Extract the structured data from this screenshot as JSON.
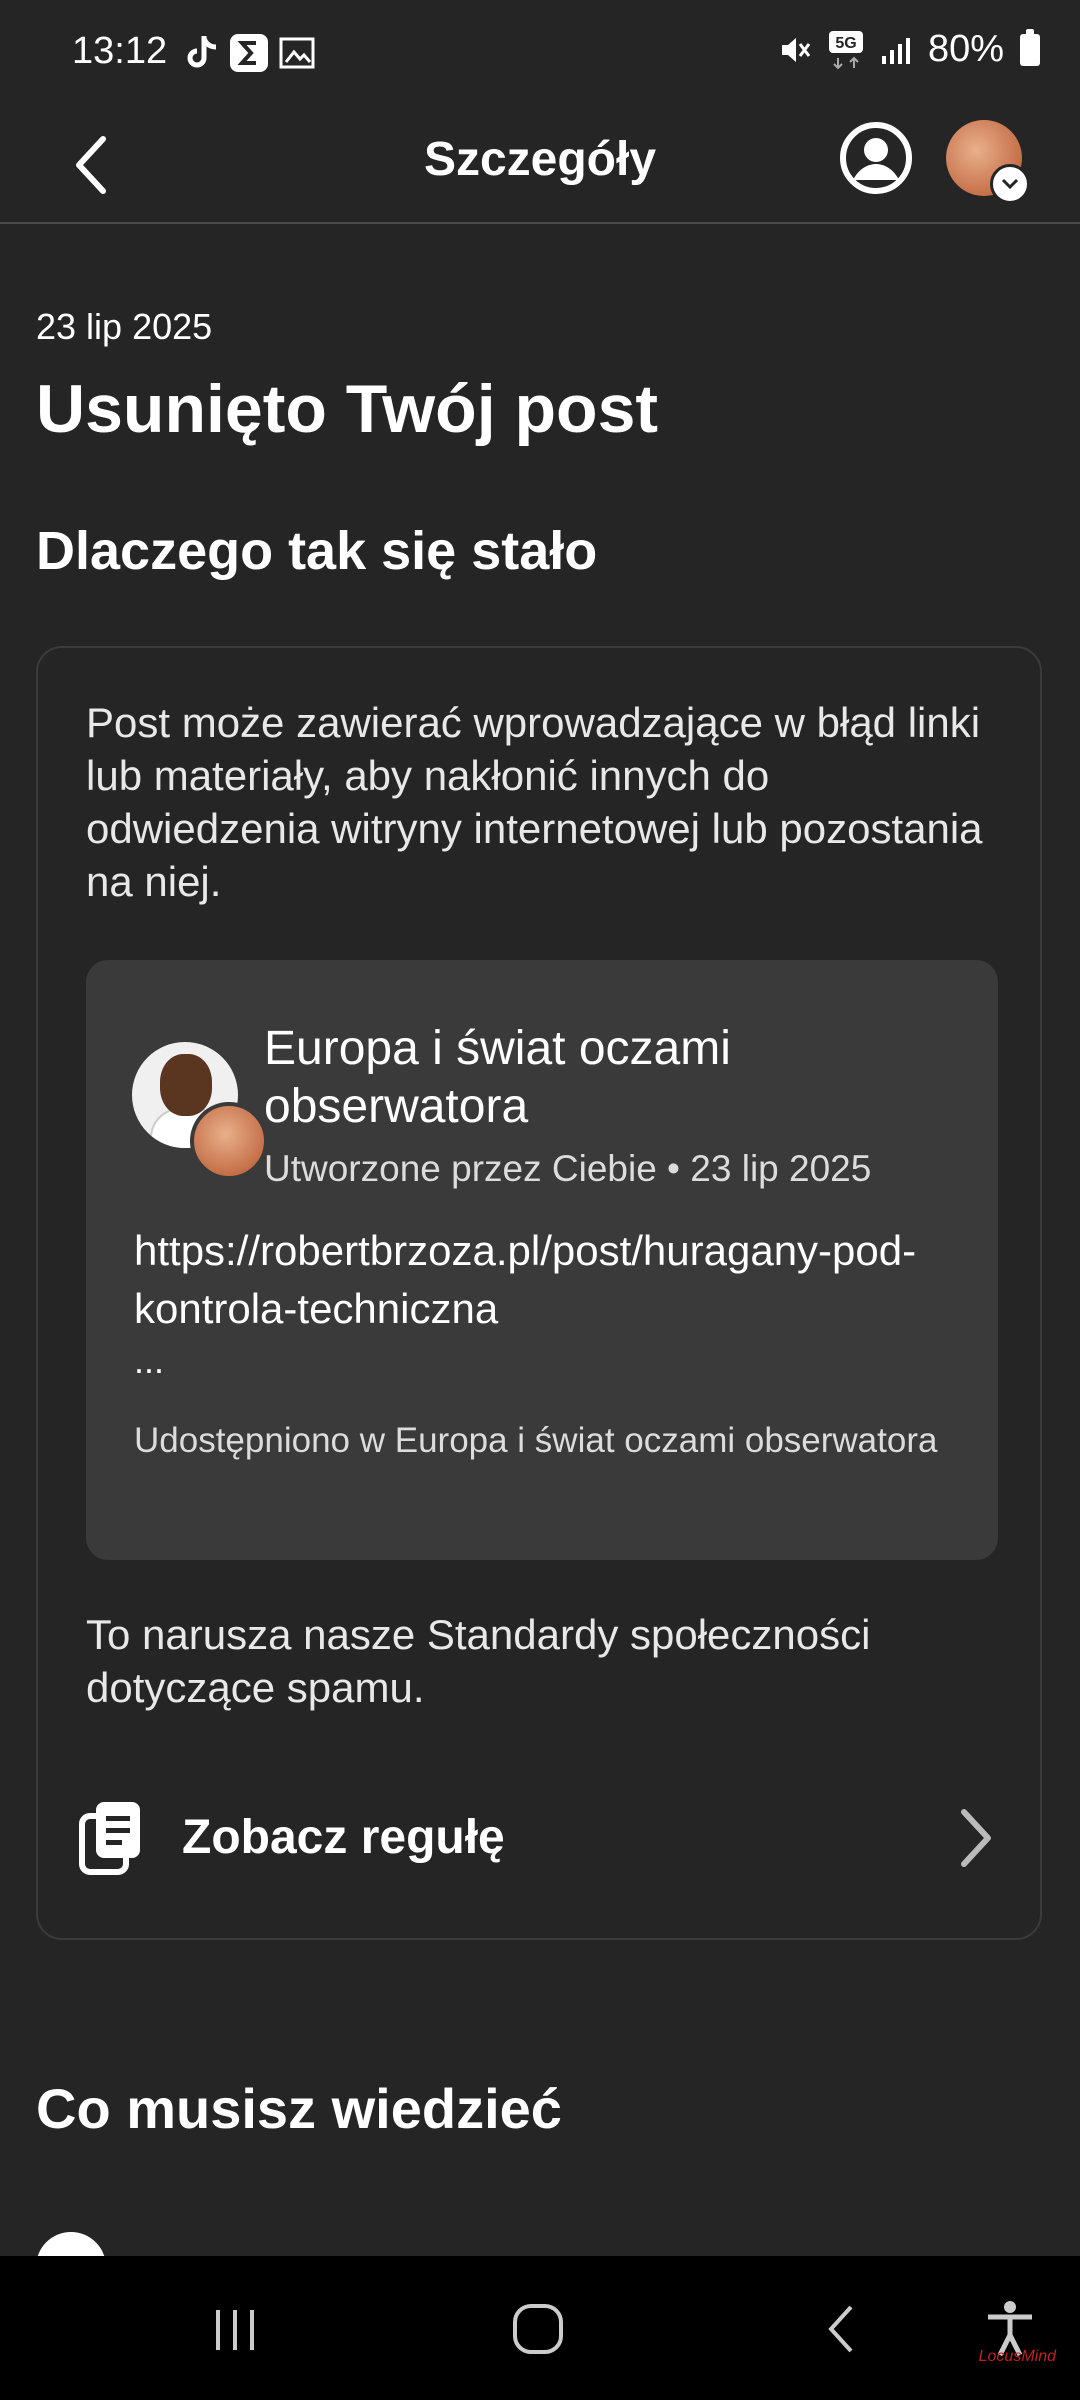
{
  "status_bar": {
    "time": "13:12",
    "battery": "80%",
    "network": "5G"
  },
  "header": {
    "title": "Szczegóły"
  },
  "notice": {
    "date": "23 lip 2025",
    "title": "Usunięto Twój post",
    "why_heading": "Dlaczego tak się stało"
  },
  "card": {
    "reason": "Post może zawierać wprowadzające w błąd linki lub materiały, aby nakłonić innych do odwiedzenia witryny internetowej lub pozostania na niej.",
    "post": {
      "title": "Europa i świat oczami obserwatora",
      "meta": "Utworzone przez Ciebie • 23 lip 2025",
      "link": "https://robertbrzoza.pl/post/huragany-pod-kontrola-techniczna",
      "ellipsis": "...",
      "shared": "Udostępniono w Europa i świat oczami obserwatora"
    },
    "violation": "To narusza nasze Standardy społeczności dotyczące spamu.",
    "rule_button": "Zobacz regułę"
  },
  "section2": {
    "heading": "Co musisz wiedzieć"
  },
  "watermark": "LocusMind"
}
